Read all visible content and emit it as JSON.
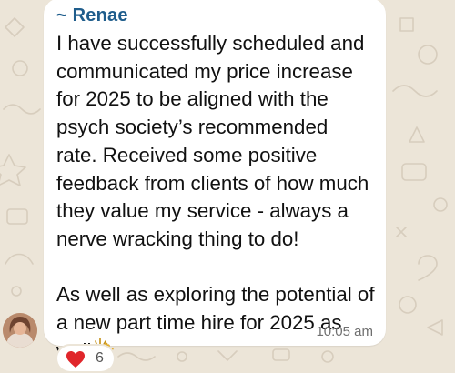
{
  "chat": {
    "sender": "~ Renae",
    "message_lines": [
      "I have successfully scheduled and",
      "communicated my price increase",
      "for 2025 to be aligned with the",
      "psych society’s recommended",
      "rate. Received some positive",
      "feedback from clients of how much",
      "they value my service - always a",
      "nerve wracking thing to do!"
    ],
    "message_lines_2": [
      "As well as exploring the potential of",
      "a new part time hire for 2025 as",
      "well"
    ],
    "time": "10:05 am",
    "reaction": {
      "icon": "heart-icon",
      "count": "6"
    },
    "colors": {
      "sender_name": "#1f5d8c",
      "wallpaper": "#ece5d8",
      "bubble": "#ffffff",
      "heart": "#e0262b"
    }
  }
}
